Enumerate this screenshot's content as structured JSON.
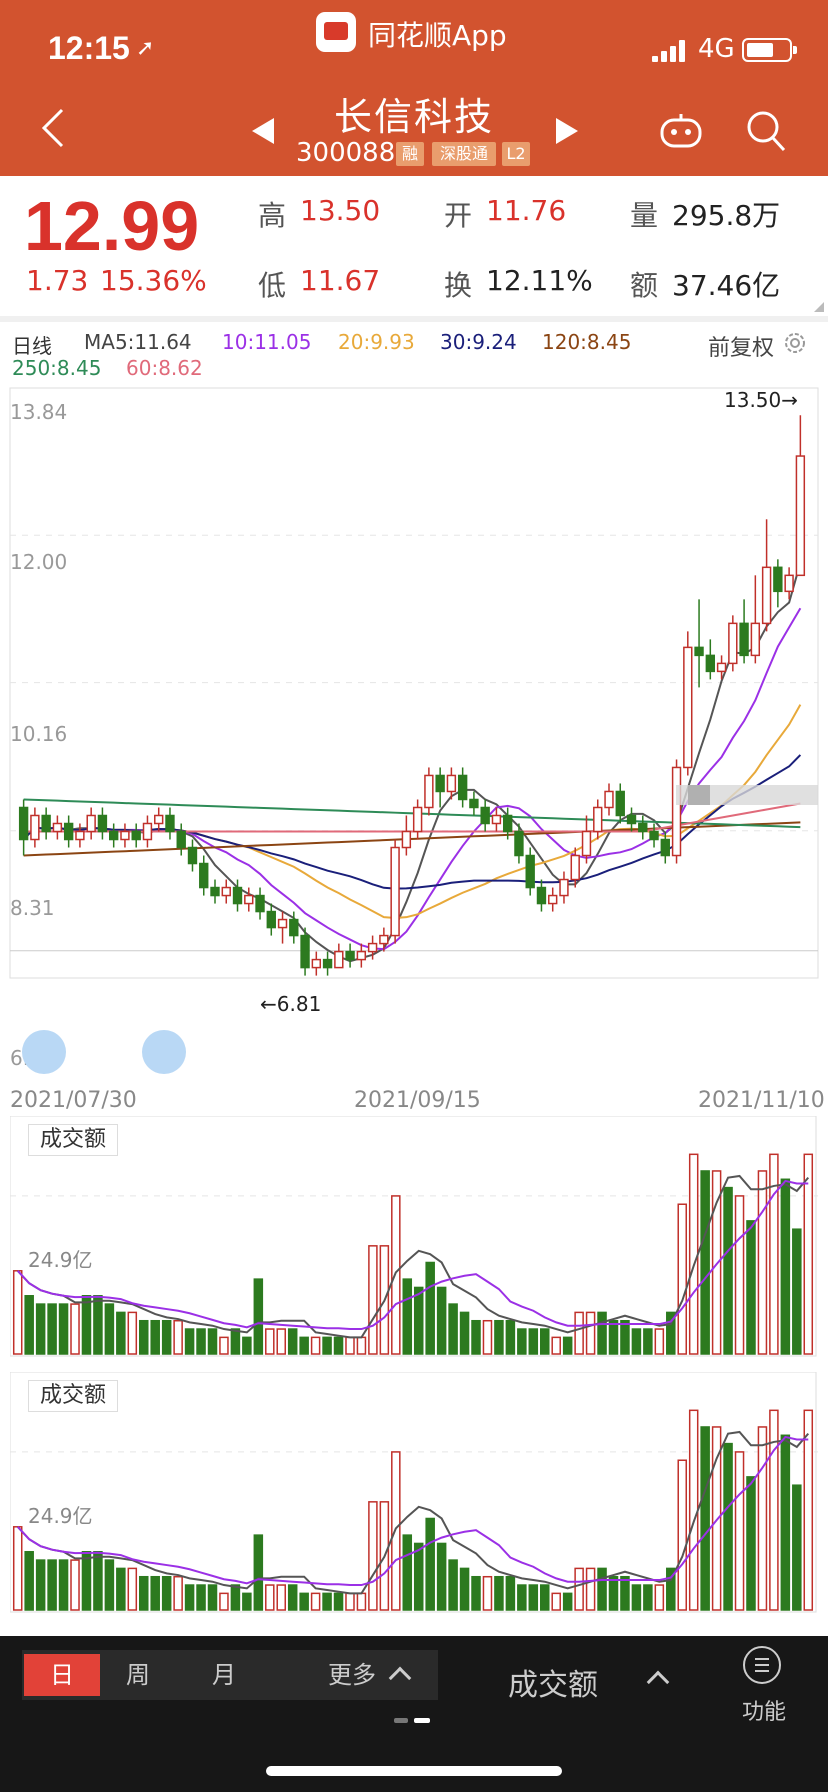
{
  "status": {
    "time": "12:15",
    "network": "4G"
  },
  "app": {
    "name": "同花顺App"
  },
  "stock": {
    "name": "长信科技",
    "code": "300088",
    "tags": [
      "融",
      "深股通",
      "L2"
    ]
  },
  "quote": {
    "price": "12.99",
    "change": "1.73",
    "change_pct": "15.36%",
    "high_label": "高",
    "high": "13.50",
    "low_label": "低",
    "low": "11.67",
    "open_label": "开",
    "open": "11.76",
    "turnover_label": "换",
    "turnover": "12.11%",
    "volume_label": "量",
    "volume": "295.8万",
    "amount_label": "额",
    "amount": "37.46亿"
  },
  "ma": {
    "period_label": "日线",
    "ma5": "MA5:11.64",
    "ma10": "10:11.05",
    "ma20": "20:9.93",
    "ma30": "30:9.24",
    "ma120": "120:8.45",
    "ma250": "250:8.45",
    "ma60": "60:8.62",
    "adjust": "前复权"
  },
  "colors": {
    "up": "#c0302a",
    "down": "#2c7a1f",
    "ma5": "#555555",
    "ma10": "#9b30e6",
    "ma20": "#e8a93a",
    "ma30": "#1a1f7a",
    "ma120": "#8b4513",
    "ma250": "#2e8b57",
    "ma60": "#e06a7a"
  },
  "chart_data": {
    "type": "candlestick",
    "y_ticks": [
      "13.84",
      "12.00",
      "10.16",
      "8.31",
      "6.47"
    ],
    "ylim": [
      6.47,
      13.84
    ],
    "dates": [
      "2021/07/30",
      "2021/09/15",
      "2021/11/10"
    ],
    "high_marker": "13.50",
    "low_marker": "6.81",
    "candles": [
      [
        8.6,
        8.2,
        8.7,
        8.0
      ],
      [
        8.2,
        8.5,
        8.6,
        8.1
      ],
      [
        8.5,
        8.3,
        8.6,
        8.2
      ],
      [
        8.3,
        8.4,
        8.5,
        8.2
      ],
      [
        8.4,
        8.2,
        8.5,
        8.1
      ],
      [
        8.2,
        8.3,
        8.4,
        8.1
      ],
      [
        8.3,
        8.5,
        8.6,
        8.2
      ],
      [
        8.5,
        8.3,
        8.6,
        8.2
      ],
      [
        8.3,
        8.2,
        8.4,
        8.1
      ],
      [
        8.2,
        8.3,
        8.4,
        8.1
      ],
      [
        8.3,
        8.2,
        8.4,
        8.1
      ],
      [
        8.2,
        8.4,
        8.5,
        8.1
      ],
      [
        8.4,
        8.5,
        8.6,
        8.3
      ],
      [
        8.5,
        8.3,
        8.6,
        8.2
      ],
      [
        8.3,
        8.1,
        8.4,
        8.0
      ],
      [
        8.1,
        7.9,
        8.2,
        7.8
      ],
      [
        7.9,
        7.6,
        8.0,
        7.5
      ],
      [
        7.6,
        7.5,
        7.7,
        7.4
      ],
      [
        7.5,
        7.6,
        7.7,
        7.4
      ],
      [
        7.6,
        7.4,
        7.7,
        7.3
      ],
      [
        7.4,
        7.5,
        7.6,
        7.3
      ],
      [
        7.5,
        7.3,
        7.6,
        7.2
      ],
      [
        7.3,
        7.1,
        7.4,
        7.0
      ],
      [
        7.1,
        7.2,
        7.3,
        6.9
      ],
      [
        7.2,
        7.0,
        7.3,
        6.9
      ],
      [
        7.0,
        6.6,
        7.1,
        6.5
      ],
      [
        6.6,
        6.7,
        6.8,
        6.5
      ],
      [
        6.7,
        6.6,
        6.8,
        6.5
      ],
      [
        6.6,
        6.8,
        6.9,
        6.6
      ],
      [
        6.8,
        6.7,
        6.9,
        6.6
      ],
      [
        6.7,
        6.8,
        6.9,
        6.6
      ],
      [
        6.8,
        6.9,
        7.0,
        6.7
      ],
      [
        6.9,
        7.0,
        7.1,
        6.8
      ],
      [
        7.0,
        8.1,
        8.2,
        6.9
      ],
      [
        8.1,
        8.3,
        8.5,
        8.0
      ],
      [
        8.3,
        8.6,
        8.7,
        8.2
      ],
      [
        8.6,
        9.0,
        9.1,
        8.5
      ],
      [
        9.0,
        8.8,
        9.1,
        8.6
      ],
      [
        8.8,
        9.0,
        9.1,
        8.7
      ],
      [
        9.0,
        8.7,
        9.1,
        8.6
      ],
      [
        8.7,
        8.6,
        8.8,
        8.5
      ],
      [
        8.6,
        8.4,
        8.7,
        8.3
      ],
      [
        8.4,
        8.5,
        8.6,
        8.3
      ],
      [
        8.5,
        8.3,
        8.6,
        8.2
      ],
      [
        8.3,
        8.0,
        8.4,
        7.9
      ],
      [
        8.0,
        7.6,
        8.1,
        7.5
      ],
      [
        7.6,
        7.4,
        7.7,
        7.3
      ],
      [
        7.4,
        7.5,
        7.6,
        7.3
      ],
      [
        7.5,
        7.7,
        7.8,
        7.4
      ],
      [
        7.7,
        8.0,
        8.1,
        7.6
      ],
      [
        8.0,
        8.3,
        8.5,
        7.9
      ],
      [
        8.3,
        8.6,
        8.7,
        8.2
      ],
      [
        8.6,
        8.8,
        8.9,
        8.5
      ],
      [
        8.8,
        8.5,
        8.9,
        8.4
      ],
      [
        8.5,
        8.4,
        8.6,
        8.3
      ],
      [
        8.4,
        8.3,
        8.5,
        8.2
      ],
      [
        8.3,
        8.2,
        8.4,
        8.1
      ],
      [
        8.2,
        8.0,
        8.3,
        7.9
      ],
      [
        8.0,
        9.1,
        9.2,
        7.9
      ],
      [
        9.1,
        10.6,
        10.8,
        9.0
      ],
      [
        10.6,
        10.5,
        11.2,
        10.1
      ],
      [
        10.5,
        10.3,
        10.7,
        10.2
      ],
      [
        10.3,
        10.4,
        10.5,
        10.2
      ],
      [
        10.4,
        10.9,
        11.0,
        10.3
      ],
      [
        10.9,
        10.5,
        11.2,
        10.4
      ],
      [
        10.5,
        10.9,
        11.5,
        10.4
      ],
      [
        10.9,
        11.6,
        12.2,
        10.8
      ],
      [
        11.6,
        11.3,
        11.7,
        11.1
      ],
      [
        11.3,
        11.5,
        11.6,
        11.2
      ],
      [
        11.5,
        12.99,
        13.5,
        11.67
      ]
    ],
    "volume_label": "成交额",
    "volume_tick": "24.9亿",
    "volumes": [
      [
        10,
        1
      ],
      [
        7,
        0
      ],
      [
        6,
        0
      ],
      [
        6,
        0
      ],
      [
        6,
        0
      ],
      [
        6,
        1
      ],
      [
        7,
        0
      ],
      [
        7,
        0
      ],
      [
        6,
        0
      ],
      [
        5,
        0
      ],
      [
        5,
        1
      ],
      [
        4,
        0
      ],
      [
        4,
        0
      ],
      [
        4,
        0
      ],
      [
        4,
        1
      ],
      [
        3,
        0
      ],
      [
        3,
        0
      ],
      [
        3,
        0
      ],
      [
        2,
        1
      ],
      [
        3,
        0
      ],
      [
        2,
        0
      ],
      [
        9,
        0
      ],
      [
        3,
        1
      ],
      [
        3,
        1
      ],
      [
        3,
        0
      ],
      [
        2,
        0
      ],
      [
        2,
        1
      ],
      [
        2,
        0
      ],
      [
        2,
        0
      ],
      [
        2,
        1
      ],
      [
        2,
        1
      ],
      [
        13,
        1
      ],
      [
        13,
        1
      ],
      [
        19,
        1
      ],
      [
        9,
        0
      ],
      [
        8,
        0
      ],
      [
        11,
        0
      ],
      [
        8,
        0
      ],
      [
        6,
        0
      ],
      [
        5,
        0
      ],
      [
        4,
        0
      ],
      [
        4,
        1
      ],
      [
        4,
        0
      ],
      [
        4,
        0
      ],
      [
        3,
        0
      ],
      [
        3,
        0
      ],
      [
        3,
        0
      ],
      [
        2,
        1
      ],
      [
        2,
        0
      ],
      [
        5,
        1
      ],
      [
        5,
        1
      ],
      [
        5,
        0
      ],
      [
        4,
        0
      ],
      [
        4,
        0
      ],
      [
        3,
        0
      ],
      [
        3,
        0
      ],
      [
        3,
        1
      ],
      [
        5,
        0
      ],
      [
        18,
        1
      ],
      [
        24,
        1
      ],
      [
        22,
        0
      ],
      [
        22,
        1
      ],
      [
        20,
        0
      ],
      [
        19,
        1
      ],
      [
        16,
        0
      ],
      [
        22,
        1
      ],
      [
        24,
        1
      ],
      [
        21,
        0
      ],
      [
        15,
        0
      ],
      [
        24,
        1
      ]
    ]
  },
  "bottom": {
    "tab_day": "日",
    "tab_week": "周",
    "tab_month": "月",
    "tab_more": "更多",
    "indicator": "成交额",
    "func_label": "功能"
  }
}
